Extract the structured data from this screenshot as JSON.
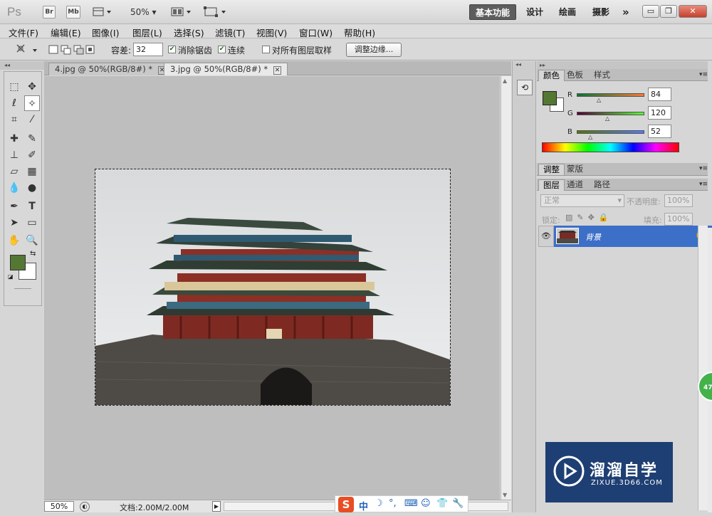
{
  "appbar": {
    "logo": "Ps",
    "br_label": "Br",
    "mb_label": "Mb",
    "zoom": "50%",
    "workspaces": [
      "基本功能",
      "设计",
      "绘画",
      "摄影"
    ],
    "more": "»"
  },
  "menu": [
    "文件(F)",
    "编辑(E)",
    "图像(I)",
    "图层(L)",
    "选择(S)",
    "滤镜(T)",
    "视图(V)",
    "窗口(W)",
    "帮助(H)"
  ],
  "options": {
    "tolerance_label": "容差:",
    "tolerance_value": "32",
    "antialias_label": "消除锯齿",
    "contiguous_label": "连续",
    "sample_all_label": "对所有图层取样",
    "refine_label": "调整边缘..."
  },
  "tabs": [
    {
      "label": "4.jpg @ 50%(RGB/8#) *",
      "active": false
    },
    {
      "label": "3.jpg @ 50%(RGB/8#) *",
      "active": true
    }
  ],
  "status": {
    "zoom": "50%",
    "doc": "文档:2.00M/2.00M"
  },
  "color_panel": {
    "tabs": [
      "颜色",
      "色板",
      "样式"
    ],
    "R": "84",
    "G": "120",
    "B": "52",
    "r_label": "R",
    "g_label": "G",
    "b_label": "B",
    "fg_color": "#547834"
  },
  "adjust_panel": {
    "tabs": [
      "调整",
      "蒙版"
    ]
  },
  "layers_panel": {
    "tabs": [
      "图层",
      "通道",
      "路径"
    ],
    "blend_mode": "正常",
    "opacity_label": "不透明度:",
    "opacity": "100%",
    "lock_label": "锁定:",
    "fill_label": "填充:",
    "fill": "100%",
    "layer_name": "背景"
  },
  "watermark": {
    "title": "溜溜自学",
    "url": "ZIXUE.3D66.COM"
  },
  "badge": "47"
}
